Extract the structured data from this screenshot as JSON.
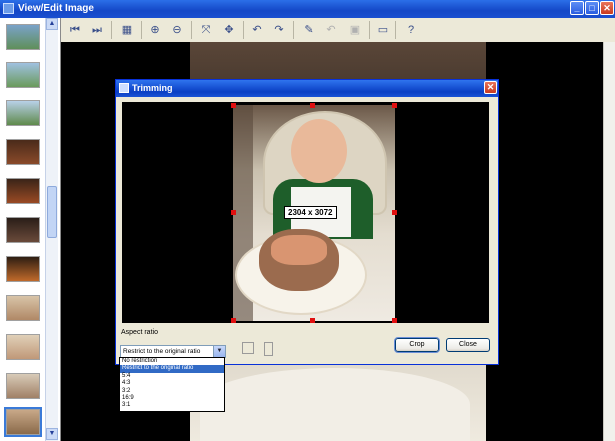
{
  "window": {
    "title": "View/Edit Image",
    "buttons": [
      "_",
      "□",
      "✕"
    ]
  },
  "toolbar": {
    "tools": [
      {
        "name": "first-image",
        "glyph": "⏮"
      },
      {
        "name": "next-image",
        "glyph": "⏭"
      },
      {
        "name": "slideshow",
        "glyph": "▦"
      },
      {
        "name": "zoom-in",
        "glyph": "⊕"
      },
      {
        "name": "zoom-out",
        "glyph": "⊖"
      },
      {
        "name": "fit-window",
        "glyph": "⤧"
      },
      {
        "name": "actual-size",
        "glyph": "✥"
      },
      {
        "name": "rotate-left",
        "glyph": "↶"
      },
      {
        "name": "rotate-right",
        "glyph": "↷"
      },
      {
        "name": "edit-effects",
        "glyph": "✎"
      },
      {
        "name": "undo",
        "glyph": "↶"
      },
      {
        "name": "save",
        "glyph": "▣"
      },
      {
        "name": "full-screen",
        "glyph": "▭"
      },
      {
        "name": "help",
        "glyph": "?"
      }
    ]
  },
  "dialog": {
    "title": "Trimming",
    "size_label": "2304 x 3072",
    "aspect_ratio_label": "Aspect ratio",
    "selected_option": "Restrict to the original ratio",
    "options": [
      "No restriction",
      "Restrict to the original ratio",
      "5:4",
      "4:3",
      "3:2",
      "16:9",
      "3:1"
    ],
    "crop_label": "Crop",
    "close_label": "Close"
  },
  "colors": {
    "title_bar": "#1447c7",
    "selection": "#316ac5",
    "crop_handle": "#e01010"
  }
}
